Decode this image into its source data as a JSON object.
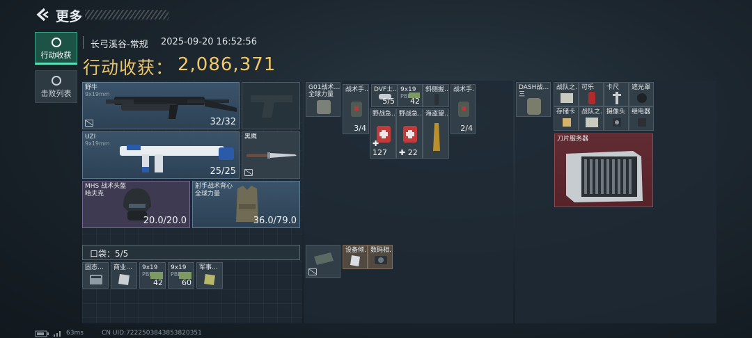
{
  "header": {
    "back_label": "更多"
  },
  "sidebar": {
    "tabs": [
      {
        "label": "行动收获"
      },
      {
        "label": "击败列表"
      }
    ]
  },
  "session": {
    "map": "长弓溪谷-常规",
    "timestamp": "2025-09-20 16:52:56"
  },
  "loot": {
    "label": "行动收获：",
    "value": "2,086,371"
  },
  "weapons": [
    {
      "name": "野牛",
      "ammo_type": "9x19mm",
      "ammo": "32/32"
    },
    {
      "name": "UZI",
      "ammo_type": "9x19mm",
      "ammo": "25/25"
    }
  ],
  "melee": {
    "name": "黑鹰"
  },
  "helmet": {
    "name": "MHS 战术头盔",
    "brand": "哈夫克",
    "durability": "20.0/20.0"
  },
  "vest": {
    "name": "射手战术背心",
    "brand": "全球力量",
    "durability": "36.0/79.0"
  },
  "pocket": {
    "label": "口袋：5/5"
  },
  "pocket_items": [
    {
      "name": "固态…",
      "count": ""
    },
    {
      "name": "商业…",
      "count": ""
    },
    {
      "name": "9x19",
      "sub": "PBP",
      "count": "42"
    },
    {
      "name": "9x19",
      "sub": "PBP",
      "count": "60"
    },
    {
      "name": "军事…",
      "count": ""
    }
  ],
  "rig": {
    "name": "G01战术…",
    "brand": "全球力量",
    "items": [
      {
        "name": "战术手…",
        "count": "3/4"
      },
      {
        "name": "DVF士…",
        "count": "5/5"
      },
      {
        "name": "9x19",
        "sub": "PBP",
        "count": "42"
      },
      {
        "name": "斜侧握…",
        "count": ""
      },
      {
        "name": "战术手…",
        "count": "2/4"
      },
      {
        "name": "野战急…",
        "count": "127"
      },
      {
        "name": "野战急…",
        "count": "22"
      },
      {
        "name": "海盗望…",
        "count": ""
      }
    ],
    "small_items": [
      {
        "name": "设备倾…"
      },
      {
        "name": "数码相…"
      }
    ]
  },
  "backpack": {
    "name": "DASH战…",
    "brand": "三",
    "items": [
      {
        "name": "战队之…"
      },
      {
        "name": "可乐"
      },
      {
        "name": "卡尺"
      },
      {
        "name": "遮光罩"
      },
      {
        "name": "存储卡"
      },
      {
        "name": "战队之…"
      },
      {
        "name": "摄像头"
      },
      {
        "name": "继电器"
      }
    ],
    "big_item": {
      "name": "刀片服务器"
    }
  },
  "footer": {
    "ping": "63ms",
    "uid": "CN UID:7222503843853820351"
  },
  "colors": {
    "accent": "#59dfb5",
    "gold": "#f0c86a",
    "red_slot": "#8e4a50"
  }
}
